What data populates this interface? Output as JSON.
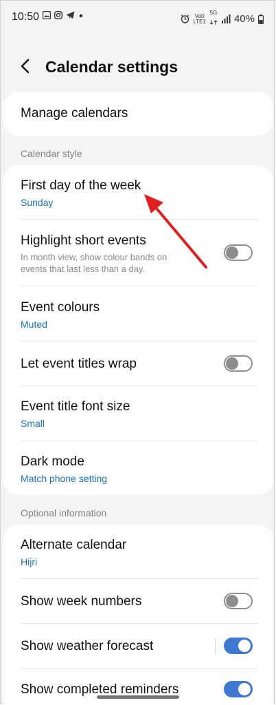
{
  "status_bar": {
    "time": "10:50",
    "battery": "40%",
    "network_top": "Vo0",
    "network_bottom": "LTE1",
    "five_g": "5G"
  },
  "header": {
    "title": "Calendar settings"
  },
  "manage": {
    "title": "Manage calendars"
  },
  "sections": {
    "calendar_style": "Calendar style",
    "optional_information": "Optional information"
  },
  "calendar_style": {
    "first_day": {
      "title": "First day of the week",
      "value": "Sunday"
    },
    "highlight": {
      "title": "Highlight short events",
      "desc": "In month view, show colour bands on events that last less than a day."
    },
    "event_colours": {
      "title": "Event colours",
      "value": "Muted"
    },
    "wrap": {
      "title": "Let event titles wrap"
    },
    "font_size": {
      "title": "Event title font size",
      "value": "Small"
    },
    "dark_mode": {
      "title": "Dark mode",
      "value": "Match phone setting"
    }
  },
  "optional": {
    "alternate": {
      "title": "Alternate calendar",
      "value": "Hijri"
    },
    "week_numbers": {
      "title": "Show week numbers"
    },
    "weather": {
      "title": "Show weather forecast"
    },
    "completed": {
      "title": "Show completed reminders"
    }
  },
  "toggles": {
    "highlight": false,
    "wrap": false,
    "week_numbers": false,
    "weather": true,
    "completed": true
  },
  "colors": {
    "accent": "#3e78d0",
    "link_blue": "#1a73b7",
    "annotation_arrow": "#e02020"
  }
}
